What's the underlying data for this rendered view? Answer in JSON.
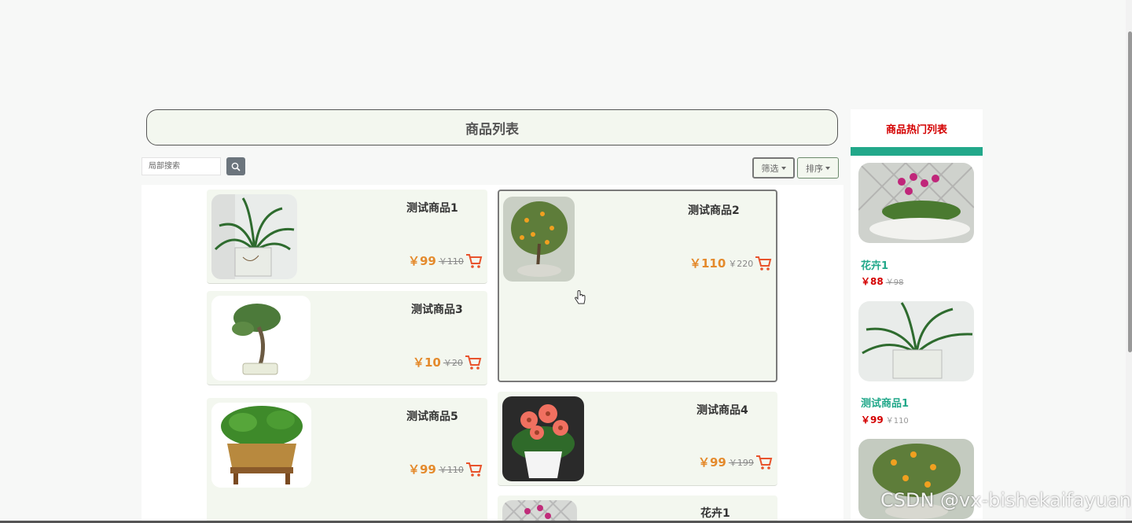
{
  "header": {
    "title": "商品列表"
  },
  "search": {
    "placeholder": "局部搜索"
  },
  "toolbar": {
    "filter_label": "筛选",
    "sort_label": "排序"
  },
  "products": [
    {
      "name": "测试商品1",
      "price": "￥99",
      "old_price": "￥110"
    },
    {
      "name": "测试商品2",
      "price": "￥110",
      "old_price": "￥220"
    },
    {
      "name": "测试商品3",
      "price": "￥10",
      "old_price": "￥20"
    },
    {
      "name": "测试商品5",
      "price": "￥99",
      "old_price": "￥110"
    },
    {
      "name": "测试商品4",
      "price": "￥99",
      "old_price": "￥199"
    },
    {
      "name": "花卉1"
    }
  ],
  "sidebar": {
    "title": "商品热门列表",
    "items": [
      {
        "name": "花卉1",
        "price": "￥88",
        "old_price": "￥98"
      },
      {
        "name": "测试商品1",
        "price": "￥99",
        "old_price": "￥110"
      }
    ]
  },
  "watermark": "CSDN @vx-bishekaifayuan",
  "colors": {
    "accent": "#22a88a",
    "price": "#e48a2c",
    "hot_title": "#d40000",
    "card_bg": "#f3f7ef"
  }
}
